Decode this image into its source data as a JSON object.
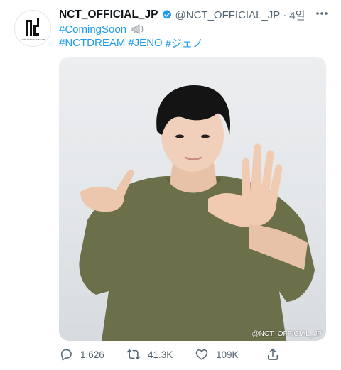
{
  "tweet": {
    "author_name": "NCT_OFFICIAL_JP",
    "handle": "@NCT_OFFICIAL_JP",
    "separator": "·",
    "time": "4일",
    "avatar_caption": "JAPAN OFFICIAL FANCLUB",
    "lines": [
      [
        "#ComingSoon"
      ],
      [
        "#NCTDREAM",
        "#JENO",
        "#ジェノ"
      ]
    ],
    "image_watermark": "@NCT_OFFICIAL_JP"
  },
  "actions": {
    "replies": "1,626",
    "retweets": "41.3K",
    "likes": "109K"
  },
  "icons": {
    "verified": "verified-badge-icon",
    "more": "more-options-icon",
    "megaphone": "megaphone-icon",
    "reply": "reply-icon",
    "retweet": "retweet-icon",
    "like": "heart-icon",
    "share": "share-icon"
  },
  "colors": {
    "link": "#1d9bf0",
    "verified": "#1d9bf0",
    "meta": "#536471",
    "text": "#0f1419"
  }
}
